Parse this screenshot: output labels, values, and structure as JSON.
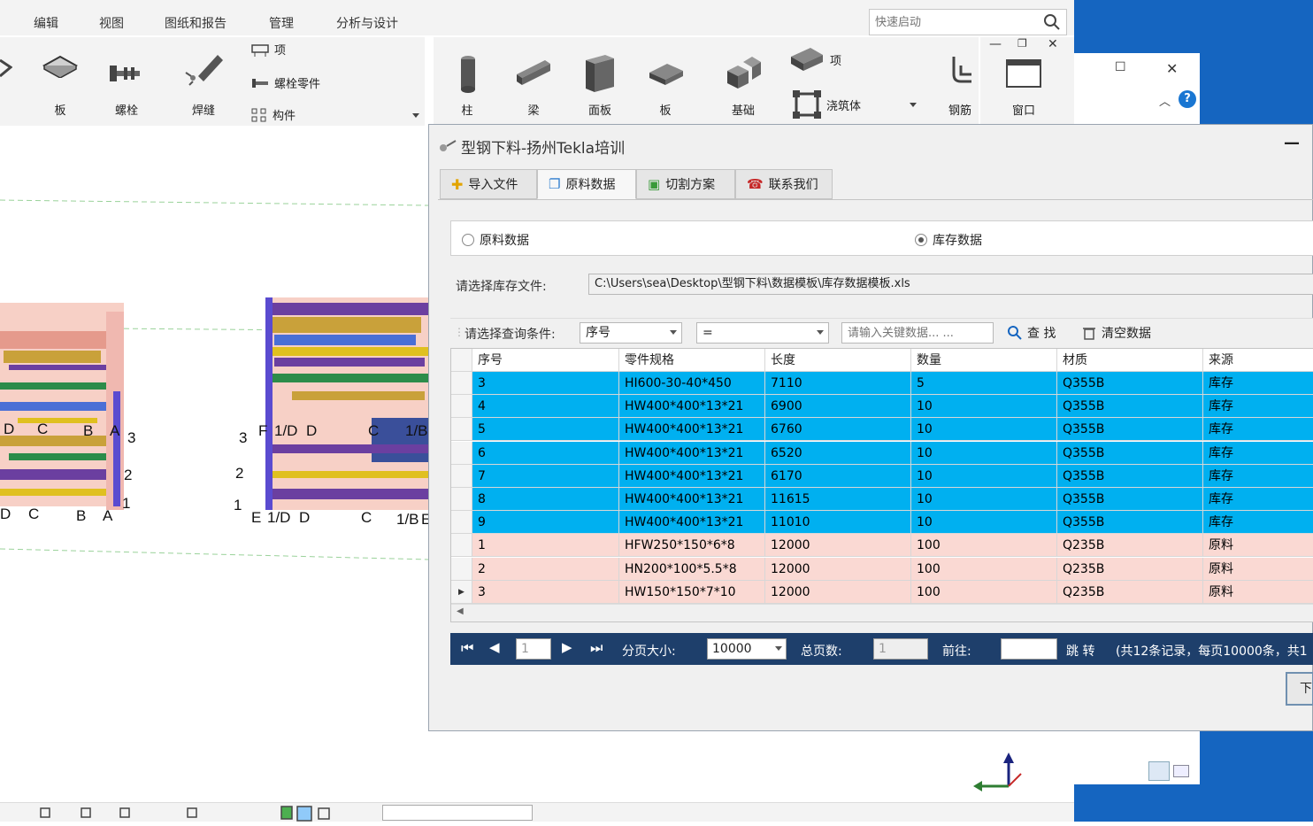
{
  "menu": {
    "items": [
      "编辑",
      "视图",
      "图纸和报告",
      "管理",
      "分析与设计"
    ],
    "search_placeholder": "快速启动"
  },
  "ribbon": {
    "left": {
      "plate": "板",
      "bolt": "螺栓",
      "weld": "焊缝",
      "item": "项",
      "bolt_part": "螺栓零件",
      "component": "构件"
    },
    "right": {
      "column": "柱",
      "beam": "梁",
      "panel": "面板",
      "slab": "板",
      "foundation": "基础",
      "item": "项",
      "pour": "浇筑体",
      "rebar": "钢筋",
      "window": "窗口"
    }
  },
  "model": {
    "grid_labels_left": [
      "D",
      "C",
      "B",
      "A",
      "3",
      "2",
      "1",
      "D",
      "C",
      "B",
      "A"
    ],
    "grid_labels_right": [
      "3",
      "F",
      "1/D",
      "D",
      "C",
      "1/B",
      "2",
      "1",
      "E",
      "1/D",
      "D",
      "C",
      "1/B",
      "E"
    ]
  },
  "dialog": {
    "title": "型钢下料-扬州Tekla培训",
    "tabs": [
      {
        "label": "导入文件",
        "icon": "import-icon"
      },
      {
        "label": "原料数据",
        "icon": "raw-data-icon"
      },
      {
        "label": "切割方案",
        "icon": "cut-plan-icon"
      },
      {
        "label": "联系我们",
        "icon": "phone-icon"
      }
    ],
    "active_tab": "原料数据",
    "radio_raw": "原料数据",
    "radio_stock": "库存数据",
    "radio_selected": "库存数据",
    "file_label": "请选择库存文件:",
    "file_path": "C:\\Users\\sea\\Desktop\\型钢下料\\数据模板\\库存数据模板.xls",
    "filter_label": "请选择查询条件:",
    "filter_field": "序号",
    "filter_op": "=",
    "keyword_placeholder": "请输入关键数据... ...",
    "search_label": "查 找",
    "clear_label": "清空数据",
    "columns": [
      "序号",
      "零件规格",
      "长度",
      "数量",
      "材质",
      "来源"
    ],
    "rows": [
      {
        "id": "3",
        "spec": "HI600-30-40*450",
        "length": "7110",
        "qty": "5",
        "material": "Q355B",
        "source": "库存",
        "type": "stock"
      },
      {
        "id": "4",
        "spec": "HW400*400*13*21",
        "length": "6900",
        "qty": "10",
        "material": "Q355B",
        "source": "库存",
        "type": "stock"
      },
      {
        "id": "5",
        "spec": "HW400*400*13*21",
        "length": "6760",
        "qty": "10",
        "material": "Q355B",
        "source": "库存",
        "type": "stock"
      },
      {
        "id": "6",
        "spec": "HW400*400*13*21",
        "length": "6520",
        "qty": "10",
        "material": "Q355B",
        "source": "库存",
        "type": "stock"
      },
      {
        "id": "7",
        "spec": "HW400*400*13*21",
        "length": "6170",
        "qty": "10",
        "material": "Q355B",
        "source": "库存",
        "type": "stock"
      },
      {
        "id": "8",
        "spec": "HW400*400*13*21",
        "length": "11615",
        "qty": "10",
        "material": "Q355B",
        "source": "库存",
        "type": "stock"
      },
      {
        "id": "9",
        "spec": "HW400*400*13*21",
        "length": "11010",
        "qty": "10",
        "material": "Q355B",
        "source": "库存",
        "type": "stock"
      },
      {
        "id": "1",
        "spec": "HFW250*150*6*8",
        "length": "12000",
        "qty": "100",
        "material": "Q235B",
        "source": "原料",
        "type": "raw"
      },
      {
        "id": "2",
        "spec": "HN200*100*5.5*8",
        "length": "12000",
        "qty": "100",
        "material": "Q235B",
        "source": "原料",
        "type": "raw"
      },
      {
        "id": "3",
        "spec": "HW150*150*7*10",
        "length": "12000",
        "qty": "100",
        "material": "Q235B",
        "source": "原料",
        "type": "raw"
      }
    ],
    "pager": {
      "page": "1",
      "page_size_label": "分页大小:",
      "page_size": "10000",
      "total_pages_label": "总页数:",
      "total_pages": "1",
      "goto_label": "前往:",
      "jump_label": "跳 转",
      "summary": "(共12条记录，每页10000条，共1"
    },
    "next_button": "下"
  },
  "colors": {
    "stock_row": "#00b0f0",
    "raw_row": "#fad9d3",
    "pager_bg": "#1e3f6b",
    "desktop": "#1565c0"
  }
}
